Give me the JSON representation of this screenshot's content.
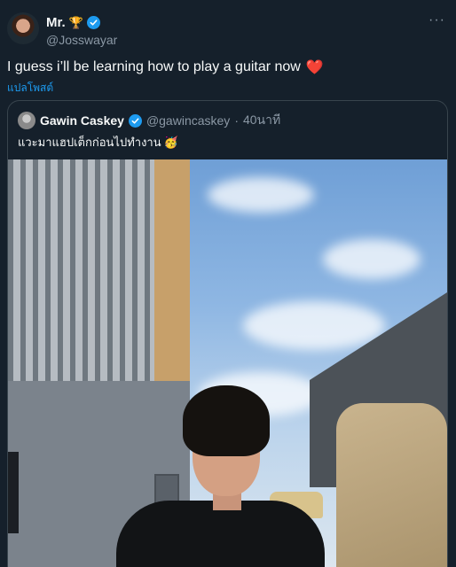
{
  "post": {
    "author_name": "Mr.",
    "author_emoji": "🏆",
    "author_handle": "@Josswayar",
    "text": "I guess i’ll be learning how to play a guitar now",
    "text_emoji": "❤️",
    "translate_label": "แปลโพสต์",
    "more_label": "···"
  },
  "quote": {
    "author_name": "Gawin Caskey",
    "author_handle": "@gawincaskey",
    "separator": "·",
    "time": "40นาที",
    "text": "แวะมาแฮปเต็กก่อนไปทำงาน",
    "text_emoji": "🥳"
  },
  "colors": {
    "background": "#15202b",
    "primary_text": "#f7f9f9",
    "secondary_text": "#8b98a5",
    "accent": "#1d9bf0",
    "border": "#38444d"
  },
  "icons": [
    "avatar",
    "verified-badge-icon",
    "more-options-icon",
    "heart-emoji",
    "party-emoji"
  ]
}
